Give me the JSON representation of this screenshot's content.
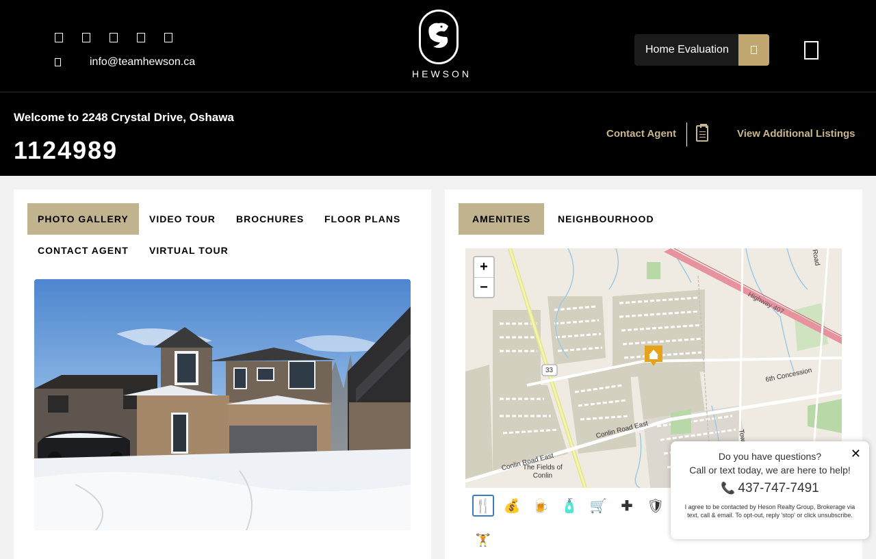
{
  "header": {
    "social_icons": [
      "facebook-icon",
      "twitter-icon",
      "instagram-icon",
      "linkedin-icon",
      "youtube-icon"
    ],
    "email": "info@teamhewson.ca",
    "logo_word": "HEWSON",
    "home_evaluation_label": "Home Evaluation"
  },
  "listing": {
    "welcome": "Welcome to 2248 Crystal Drive, Oshawa",
    "mls_number": "1124989",
    "contact_agent": "Contact Agent",
    "view_additional": "View Additional Listings"
  },
  "left_tabs": [
    {
      "label": "PHOTO GALLERY",
      "active": true
    },
    {
      "label": "VIDEO TOUR",
      "active": false
    },
    {
      "label": "BROCHURES",
      "active": false
    },
    {
      "label": "FLOOR PLANS",
      "active": false
    },
    {
      "label": "CONTACT AGENT",
      "active": false
    },
    {
      "label": "VIRTUAL TOUR",
      "active": false
    }
  ],
  "right_tabs": [
    {
      "label": "AMENITIES",
      "active": true
    },
    {
      "label": "NEIGHBOURHOOD",
      "active": false
    }
  ],
  "map": {
    "zoom_in": "+",
    "zoom_out": "−",
    "labels": {
      "highway_407": "Highway 407",
      "road_33": "33",
      "sixth_concession": "6th Concession",
      "conlin_east_1": "Conlin Road East",
      "conlin_east_2": "Conlin Road East",
      "fields_line1": "The Fields of",
      "fields_line2": "Conlin",
      "road_top": "Road",
      "tow": "Tow"
    }
  },
  "amenity_icons": [
    "restaurant-icon",
    "bank-icon",
    "bar-icon",
    "grocery-icon",
    "shopping-icon",
    "hospital-icon",
    "police-icon"
  ],
  "amenity_icon_row2": "fitness-icon",
  "chat": {
    "close": "✕",
    "question": "Do you have questions?",
    "subtitle": "Call or text today, we are here to help!",
    "phone": "437-747-7491",
    "fine_print": "I agree to be contacted by Heson Realty Group, Brokerage via text, call & email. To opt-out, reply 'stop' or click unsubscribe."
  },
  "colors": {
    "accent_gold": "#c1a670",
    "tab_active": "#c1b38e",
    "link_gold": "#c9b68a"
  }
}
